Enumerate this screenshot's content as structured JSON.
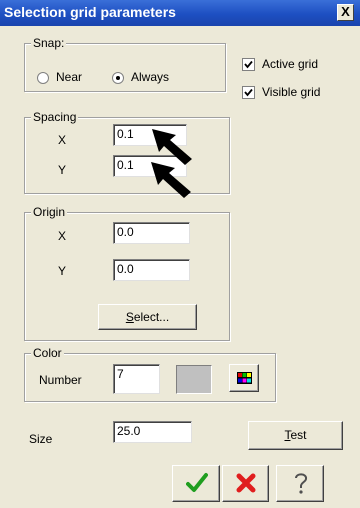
{
  "window": {
    "title": "Selection grid parameters",
    "close_label": "X"
  },
  "snap": {
    "label": "Snap:",
    "near_label": "Near",
    "always_label": "Always",
    "selected": "Always"
  },
  "active_grid": {
    "label": "Active grid",
    "checked": true
  },
  "visible_grid": {
    "label": "Visible grid",
    "checked": true
  },
  "spacing": {
    "label": "Spacing",
    "x_label": "X",
    "x_value": "0.1",
    "y_label": "Y",
    "y_value": "0.1"
  },
  "origin": {
    "label": "Origin",
    "x_label": "X",
    "x_value": "0.0",
    "y_label": "Y",
    "y_value": "0.0",
    "select_label": "Select..."
  },
  "color": {
    "label": "Color",
    "number_label": "Number",
    "number_value": "7"
  },
  "size": {
    "label": "Size",
    "value": "25.0"
  },
  "buttons": {
    "test_label": "Test"
  },
  "icons": {
    "ok": "checkmark-icon",
    "cancel": "cross-icon",
    "help": "question-icon",
    "palette": "color-palette-icon",
    "annotation_arrows": "pointer-arrow-icon"
  }
}
